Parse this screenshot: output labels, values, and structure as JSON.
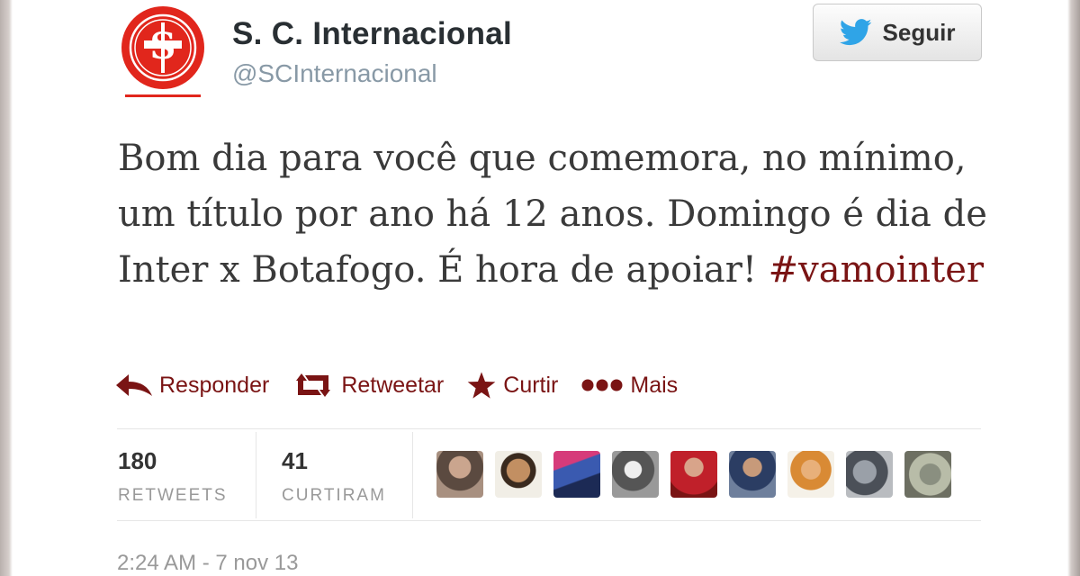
{
  "profile": {
    "name": "S. C. Internacional",
    "handle": "@SCInternacional",
    "logo_text": "SOCIEDADE ESPORTIVA INTERNACIONAL 1909"
  },
  "follow_button": {
    "label": "Seguir",
    "icon": "twitter-bird-icon"
  },
  "tweet": {
    "text": "Bom dia para você que comemora, no mínimo, um título por ano há 12 anos. Domingo é dia de Inter x Botafogo. É hora de apoiar!",
    "hashtag": "#vamointer"
  },
  "actions": [
    {
      "label": "Responder",
      "icon": "reply-icon"
    },
    {
      "label": "Retweetar",
      "icon": "retweet-icon"
    },
    {
      "label": "Curtir",
      "icon": "star-icon"
    },
    {
      "label": "Mais",
      "icon": "more-icon"
    }
  ],
  "stats": {
    "retweets": {
      "count": "180",
      "label": "RETWEETS"
    },
    "likes": {
      "count": "41",
      "label": "CURTIRAM"
    }
  },
  "avatars_count": 9,
  "timestamp": "2:24 AM - 7 nov 13",
  "colors": {
    "accent": "#7a1414",
    "logo_red": "#e1261c",
    "twitter_blue": "#2fa4e7"
  }
}
